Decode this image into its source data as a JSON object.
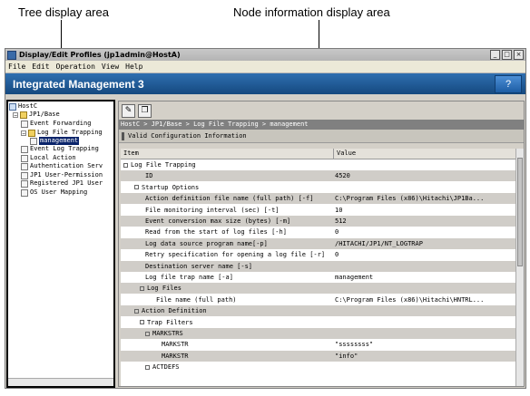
{
  "annotations": {
    "tree_area": "Tree display area",
    "node_area": "Node information display area"
  },
  "window": {
    "title": "Display/Edit Profiles (jp1admin@HostA)",
    "menu": [
      "File",
      "Edit",
      "Operation",
      "View",
      "Help"
    ],
    "banner_title": "Integrated Management 3",
    "help_label": "?"
  },
  "tree": {
    "items": [
      {
        "label": "HostC",
        "icon": "host-icon",
        "toggle": ""
      },
      {
        "label": "JP1/Base",
        "icon": "folder-icon",
        "toggle": "−"
      },
      {
        "label": "Event Forwarding",
        "icon": "file-icon",
        "toggle": ""
      },
      {
        "label": "Log File Trapping",
        "icon": "folder-icon",
        "toggle": "−"
      },
      {
        "label": "management",
        "icon": "file-icon",
        "toggle": "",
        "selected": true
      },
      {
        "label": "Event Log Trapping",
        "icon": "file-icon",
        "toggle": ""
      },
      {
        "label": "Local Action",
        "icon": "file-icon",
        "toggle": ""
      },
      {
        "label": "Authentication Serv",
        "icon": "file-icon",
        "toggle": ""
      },
      {
        "label": "JP1 User-Permission",
        "icon": "file-icon",
        "toggle": ""
      },
      {
        "label": "Registered JP1 User",
        "icon": "file-icon",
        "toggle": ""
      },
      {
        "label": "OS User Mapping",
        "icon": "file-icon",
        "toggle": ""
      }
    ]
  },
  "info": {
    "breadcrumb": "HostC > JP1/Base > Log File Trapping > management",
    "section_title": "Valid Configuration Information",
    "columns": {
      "item": "Item",
      "value": "Value"
    },
    "rows": [
      {
        "item": "Log File Trapping",
        "value": "",
        "indent": 0,
        "toggle": true,
        "shade": false
      },
      {
        "item": "ID",
        "value": "4520",
        "indent": 2,
        "toggle": false,
        "shade": true
      },
      {
        "item": "Startup Options",
        "value": "",
        "indent": 1,
        "toggle": true,
        "shade": false
      },
      {
        "item": "Action definition file name (full path) [-f]",
        "value": "C:\\Program Files (x86)\\Hitachi\\JP1Ba...",
        "indent": 2,
        "toggle": false,
        "shade": true
      },
      {
        "item": "File monitoring interval (sec) [-t]",
        "value": "10",
        "indent": 2,
        "toggle": false,
        "shade": false
      },
      {
        "item": "Event conversion max size (bytes) [-m]",
        "value": "512",
        "indent": 2,
        "toggle": false,
        "shade": true
      },
      {
        "item": "Read from the start of log files [-h]",
        "value": "0",
        "indent": 2,
        "toggle": false,
        "shade": false
      },
      {
        "item": "Log data source program name[-p]",
        "value": "/HITACHI/JP1/NT_LOGTRAP",
        "indent": 2,
        "toggle": false,
        "shade": true
      },
      {
        "item": "Retry specification for opening a log file [-r]",
        "value": "0",
        "indent": 2,
        "toggle": false,
        "shade": false
      },
      {
        "item": "Destination server name [-s]",
        "value": "",
        "indent": 2,
        "toggle": false,
        "shade": true
      },
      {
        "item": "Log file trap name [-a]",
        "value": "management",
        "indent": 2,
        "toggle": false,
        "shade": false
      },
      {
        "item": "Log Files",
        "value": "",
        "indent": 1.5,
        "toggle": true,
        "shade": true
      },
      {
        "item": "File name (full path)",
        "value": "C:\\Program Files (x86)\\Hitachi\\HNTRL...",
        "indent": 3,
        "toggle": false,
        "shade": false
      },
      {
        "item": "Action Definition",
        "value": "",
        "indent": 1,
        "toggle": true,
        "shade": true
      },
      {
        "item": "Trap Filters",
        "value": "",
        "indent": 1.5,
        "toggle": true,
        "shade": false
      },
      {
        "item": "MARKSTRS",
        "value": "",
        "indent": 2,
        "toggle": true,
        "shade": true
      },
      {
        "item": "MARKSTR",
        "value": "\"ssssssss\"",
        "indent": 3.5,
        "toggle": false,
        "shade": false
      },
      {
        "item": "MARKSTR",
        "value": "\"info\"",
        "indent": 3.5,
        "toggle": false,
        "shade": true
      },
      {
        "item": "ACTDEFS",
        "value": "",
        "indent": 2,
        "toggle": true,
        "shade": false
      }
    ]
  }
}
